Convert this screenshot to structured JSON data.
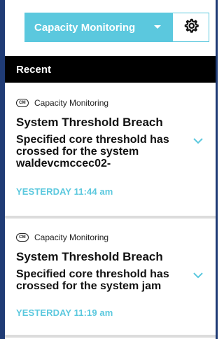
{
  "header": {
    "dropdown_label": "Capacity Monitoring",
    "caret_icon": "chevron-down-icon",
    "settings_icon": "gear-icon"
  },
  "recent": {
    "label": "Recent"
  },
  "notifications": [
    {
      "source_badge": "CM",
      "source": "Capacity Monitoring",
      "title": "System Threshold Breach",
      "body": "Specified core threshold has crossed for the system waldevcmccec02-",
      "time": "YESTERDAY 11:44 am"
    },
    {
      "source_badge": "CM",
      "source": "Capacity Monitoring",
      "title": "System Threshold Breach",
      "body": "Specified core threshold has crossed for the system jam",
      "time": "YESTERDAY 11:19 am"
    }
  ],
  "colors": {
    "accent": "#5bc8de",
    "edge": "#1f3b75",
    "bar": "#000000"
  }
}
